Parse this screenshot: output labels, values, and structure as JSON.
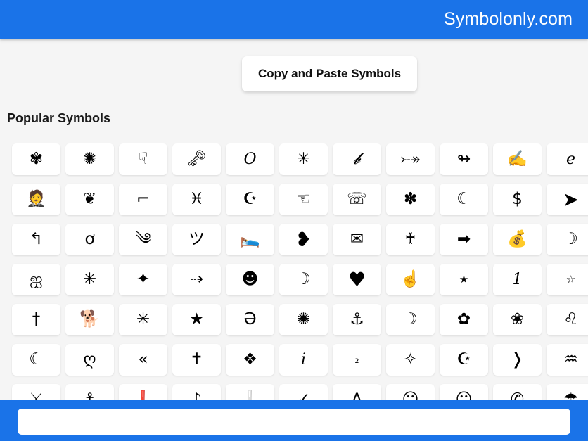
{
  "header": {
    "site_title": "Symbolonly.com",
    "background_color": "#1a73e8",
    "text_color": "#ffffff"
  },
  "title_card": {
    "label": "Copy and Paste Symbols"
  },
  "section": {
    "heading": "Popular Symbols"
  },
  "page": {
    "background_color": "#f5f5f5",
    "tile_color": "#ffffff"
  },
  "bottom_bar": {
    "background_color": "#1a73e8",
    "input_value": "",
    "input_placeholder": ""
  },
  "grid": {
    "columns": 11,
    "rows": [
      {
        "cells": [
          {
            "glyph": "✾",
            "name": "symbol-flower-punctuation"
          },
          {
            "glyph": "✺",
            "name": "symbol-sixteen-pointed-asterisk"
          },
          {
            "glyph": "☟",
            "name": "symbol-pointing-hand-down"
          },
          {
            "glyph": "🗝",
            "name": "symbol-screw"
          },
          {
            "glyph": "𝑂",
            "name": "symbol-italic-capital-o"
          },
          {
            "glyph": "✳",
            "name": "symbol-eight-spoked-asterisk"
          },
          {
            "glyph": "𝓫",
            "name": "symbol-script-small-b"
          },
          {
            "glyph": "⤐",
            "name": "symbol-feathered-arrow-right"
          },
          {
            "glyph": "↬",
            "name": "symbol-looped-arrow-right"
          },
          {
            "glyph": "✍️",
            "name": "symbol-writing-hand"
          },
          {
            "glyph": "𝑒",
            "name": "symbol-italic-small-e"
          }
        ]
      },
      {
        "cells": [
          {
            "glyph": "🤵",
            "name": "symbol-person-in-tuxedo"
          },
          {
            "glyph": "❦",
            "name": "symbol-floral-heart"
          },
          {
            "glyph": "⌐",
            "name": "symbol-angle-bracket-shape"
          },
          {
            "glyph": "♓",
            "name": "symbol-pisces"
          },
          {
            "glyph": "☪",
            "name": "symbol-star-and-crescent"
          },
          {
            "glyph": "☜",
            "name": "symbol-pointing-hand-left"
          },
          {
            "glyph": "☏",
            "name": "symbol-telephone"
          },
          {
            "glyph": "✽",
            "name": "symbol-heavy-teardrop-asterisk"
          },
          {
            "glyph": "☾",
            "name": "symbol-last-quarter-moon"
          },
          {
            "glyph": "$",
            "name": "symbol-dollar-sign"
          },
          {
            "glyph": "➤",
            "name": "symbol-black-arrowhead"
          }
        ]
      },
      {
        "cells": [
          {
            "glyph": "↰",
            "name": "symbol-arrow-turn-up-left"
          },
          {
            "glyph": "ơ",
            "name": "symbol-o-with-horn"
          },
          {
            "glyph": "༄",
            "name": "symbol-tibetan-mark-head"
          },
          {
            "glyph": "ツ",
            "name": "symbol-katakana-tsu"
          },
          {
            "glyph": "🛌",
            "name": "symbol-person-in-bed"
          },
          {
            "glyph": "❥",
            "name": "symbol-rotated-heavy-heart-bullet"
          },
          {
            "glyph": "✉",
            "name": "symbol-envelope"
          },
          {
            "glyph": "♰",
            "name": "symbol-west-syriac-cross"
          },
          {
            "glyph": "➡",
            "name": "symbol-black-rightwards-arrow"
          },
          {
            "glyph": "💰",
            "name": "symbol-money-bag"
          },
          {
            "glyph": "☽",
            "name": "symbol-first-quarter-moon"
          }
        ]
      },
      {
        "cells": [
          {
            "glyph": "ஐ",
            "name": "symbol-tamil-ai"
          },
          {
            "glyph": "✳",
            "name": "symbol-eight-spoked-asterisk-2"
          },
          {
            "glyph": "✦",
            "name": "symbol-black-four-pointed-star"
          },
          {
            "glyph": "⇢",
            "name": "symbol-dashed-arrow-right"
          },
          {
            "glyph": "☻",
            "name": "symbol-black-smiling-face"
          },
          {
            "glyph": "☽",
            "name": "symbol-crescent-moon-right"
          },
          {
            "glyph": "♥",
            "name": "symbol-black-heart-suit"
          },
          {
            "glyph": "☝️",
            "name": "symbol-index-pointing-up"
          },
          {
            "glyph": "★",
            "name": "symbol-black-star-small"
          },
          {
            "glyph": "1",
            "name": "symbol-digit-one"
          },
          {
            "glyph": "☆",
            "name": "symbol-white-star-small"
          }
        ]
      },
      {
        "cells": [
          {
            "glyph": "†",
            "name": "symbol-dagger"
          },
          {
            "glyph": "🐕",
            "name": "symbol-dog"
          },
          {
            "glyph": "✳",
            "name": "symbol-eight-spoked-asterisk-3"
          },
          {
            "glyph": "★",
            "name": "symbol-black-star"
          },
          {
            "glyph": "Ә",
            "name": "symbol-capital-schwa"
          },
          {
            "glyph": "✺",
            "name": "symbol-sixteen-pointed-asterisk-2"
          },
          {
            "glyph": "⚓",
            "name": "symbol-anchor"
          },
          {
            "glyph": "☽",
            "name": "symbol-crescent-moon-2"
          },
          {
            "glyph": "✿",
            "name": "symbol-black-florette"
          },
          {
            "glyph": "❀",
            "name": "symbol-white-florette"
          },
          {
            "glyph": "♌",
            "name": "symbol-leo"
          }
        ]
      },
      {
        "cells": [
          {
            "glyph": "☾",
            "name": "symbol-thin-crescent"
          },
          {
            "glyph": "ღ",
            "name": "symbol-georgian-ghan-heart"
          },
          {
            "glyph": "«",
            "name": "symbol-left-double-angle-quote"
          },
          {
            "glyph": "✝",
            "name": "symbol-latin-cross"
          },
          {
            "glyph": "❖",
            "name": "symbol-black-diamond-minus-white-x"
          },
          {
            "glyph": "𝑖",
            "name": "symbol-italic-small-i"
          },
          {
            "glyph": "₂",
            "name": "symbol-subscript-two"
          },
          {
            "glyph": "✧",
            "name": "symbol-white-four-pointed-star"
          },
          {
            "glyph": "☪",
            "name": "symbol-star-and-crescent-2"
          },
          {
            "glyph": "❭",
            "name": "symbol-heavy-right-angle-bracket"
          },
          {
            "glyph": "♒",
            "name": "symbol-aquarius"
          }
        ]
      },
      {
        "cells": [
          {
            "glyph": "⚔",
            "name": "symbol-crossed-swords"
          },
          {
            "glyph": "⚓",
            "name": "symbol-anchor-2"
          },
          {
            "glyph": "❗",
            "name": "symbol-exclamation-mark"
          },
          {
            "glyph": "♪",
            "name": "symbol-eighth-note"
          },
          {
            "glyph": "❕",
            "name": "symbol-white-exclamation"
          },
          {
            "glyph": "✓",
            "name": "symbol-check-mark"
          },
          {
            "glyph": "∆",
            "name": "symbol-triangle"
          },
          {
            "glyph": "☺",
            "name": "symbol-white-smiling-face"
          },
          {
            "glyph": "☹",
            "name": "symbol-white-frowning-face"
          },
          {
            "glyph": "✆",
            "name": "symbol-telephone-location"
          },
          {
            "glyph": "☂",
            "name": "symbol-umbrella"
          }
        ]
      }
    ]
  }
}
